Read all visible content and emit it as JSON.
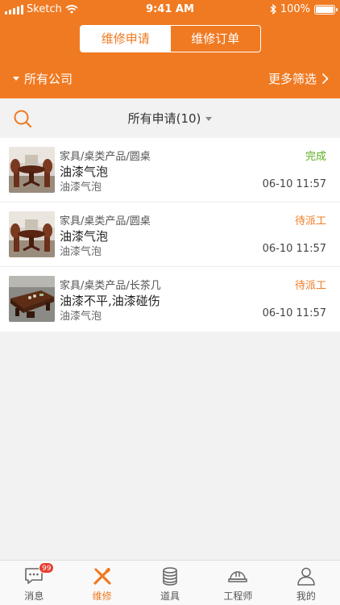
{
  "status_bar": {
    "carrier": "Sketch",
    "time": "9:41 AM",
    "battery": "100%"
  },
  "segment": {
    "tabs": [
      {
        "label": "维修申请",
        "active": true
      },
      {
        "label": "维修订单",
        "active": false
      }
    ]
  },
  "filters": {
    "company": "所有公司",
    "more": "更多筛选"
  },
  "search": {
    "filter_label": "所有申请(10)"
  },
  "colors": {
    "accent": "#f07a22",
    "done": "#5cae1e",
    "badge": "#e63c2e"
  },
  "list": [
    {
      "category": "家具/桌类产品/圆桌",
      "title": "油漆气泡",
      "desc": "油漆气泡",
      "status": "完成",
      "status_type": "done",
      "time": "06-10 11:57",
      "thumb": "round-table-photo"
    },
    {
      "category": "家具/桌类产品/圆桌",
      "title": "油漆气泡",
      "desc": "油漆气泡",
      "status": "待派工",
      "status_type": "wait",
      "time": "06-10 11:57",
      "thumb": "round-table-photo"
    },
    {
      "category": "家具/桌类产品/长茶几",
      "title": "油漆不平,油漆碰伤",
      "desc": "油漆气泡",
      "status": "待派工",
      "status_type": "wait",
      "time": "06-10 11:57",
      "thumb": "long-tea-table-photo"
    }
  ],
  "tabbar": {
    "badge": "99",
    "items": [
      {
        "label": "消息",
        "icon": "message-icon"
      },
      {
        "label": "维修",
        "icon": "tools-icon",
        "active": true
      },
      {
        "label": "道具",
        "icon": "coins-stack-icon"
      },
      {
        "label": "工程师",
        "icon": "hardhat-icon"
      },
      {
        "label": "我的",
        "icon": "user-icon"
      }
    ]
  }
}
